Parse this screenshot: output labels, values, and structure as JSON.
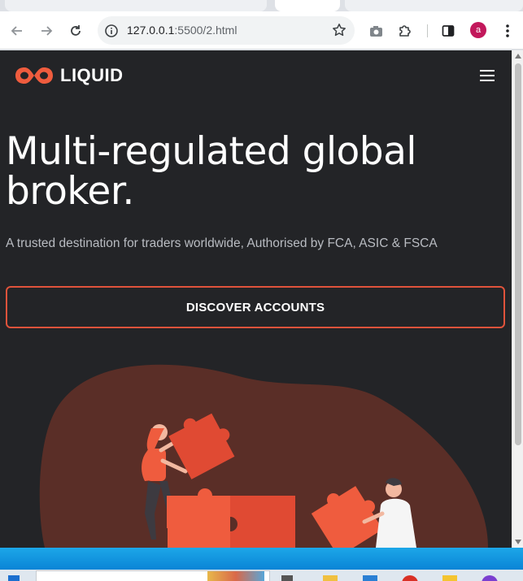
{
  "browser": {
    "url_host": "127.0.0.1",
    "url_path": ":5500/2.html",
    "profile_initial": "a"
  },
  "site": {
    "brand": "LIQUID",
    "accent_color": "#e0533b",
    "background_color": "#232427"
  },
  "hero": {
    "title": "Multi-regulated global broker.",
    "subtitle": "A trusted destination for traders worldwide, Authorised by FCA, ASIC & FSCA",
    "cta_label": "DISCOVER ACCOUNTS"
  },
  "icons": {
    "back": "arrow-left-icon",
    "forward": "arrow-right-icon",
    "reload": "reload-icon",
    "site_info": "info-icon",
    "bookmark": "star-icon",
    "screenshot": "camera-icon",
    "extensions": "puzzle-icon",
    "side_panel": "side-panel-icon",
    "menu": "kebab-menu-icon",
    "site_menu": "hamburger-icon",
    "logo": "infinity-logo-icon"
  }
}
